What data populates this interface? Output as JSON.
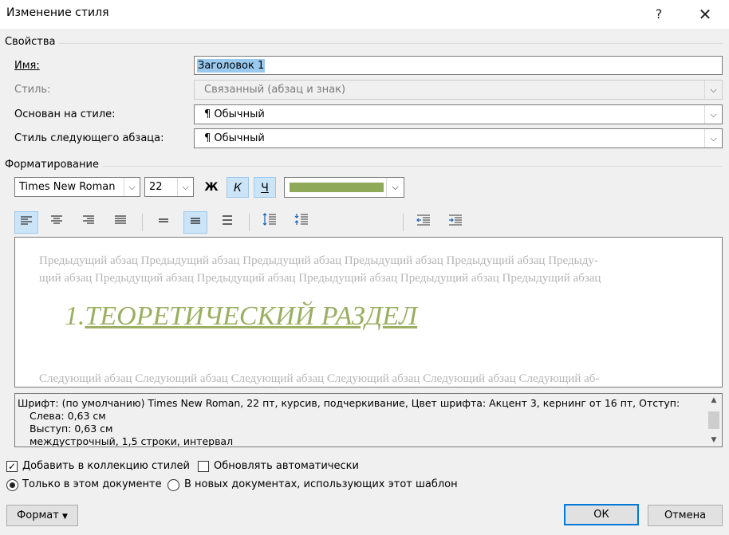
{
  "window": {
    "title": "Изменение стиля",
    "help": "?",
    "close": "✕"
  },
  "properties": {
    "section_label": "Свойства",
    "name_label": "Имя:",
    "name_value": "Заголовок 1",
    "style_type_label": "Стиль:",
    "style_type_value": "Связанный (абзац и знак)",
    "based_on_label": "Основан на стиле:",
    "based_on_value": "¶  Обычный",
    "next_style_label": "Стиль следующего абзаца:",
    "next_style_value": "¶  Обычный"
  },
  "formatting": {
    "section_label": "Форматирование",
    "font": "Times New Roman",
    "size": "22",
    "bold": "Ж",
    "italic": "К",
    "underline": "Ч",
    "color": "#8ea957"
  },
  "preview": {
    "prev_line1": "Предыдущий абзац Предыдущий абзац Предыдущий абзац Предыдущий абзац Предыдущий абзац Предыду-",
    "prev_line2": "щий абзац Предыдущий абзац Предыдущий абзац Предыдущий абзац Предыдущий абзац Предыдущий абзац",
    "heading_number": "1.",
    "heading_text": "ТЕОРЕТИЧЕСКИЙ РАЗДЕЛ",
    "next_line1": "Следующий абзац Следующий абзац Следующий абзац Следующий абзац Следующий абзац Следующий аб-"
  },
  "description": {
    "line1": "Шрифт: (по умолчанию) Times New Roman, 22 пт, курсив, подчеркивание, Цвет шрифта: Акцент 3, кернинг от 16 пт, Отступ:",
    "line2": "Слева:  0,63 см",
    "line3": "Выступ:  0,63 см",
    "line4": "междустрочный,  1,5 строки, интервал"
  },
  "options": {
    "add_to_gallery": "Добавить в коллекцию стилей",
    "auto_update": "Обновлять автоматически",
    "only_this_doc": "Только в этом документе",
    "new_docs": "В новых документах, использующих этот шаблон"
  },
  "buttons": {
    "format": "Формат",
    "ok": "ОК",
    "cancel": "Отмена"
  }
}
